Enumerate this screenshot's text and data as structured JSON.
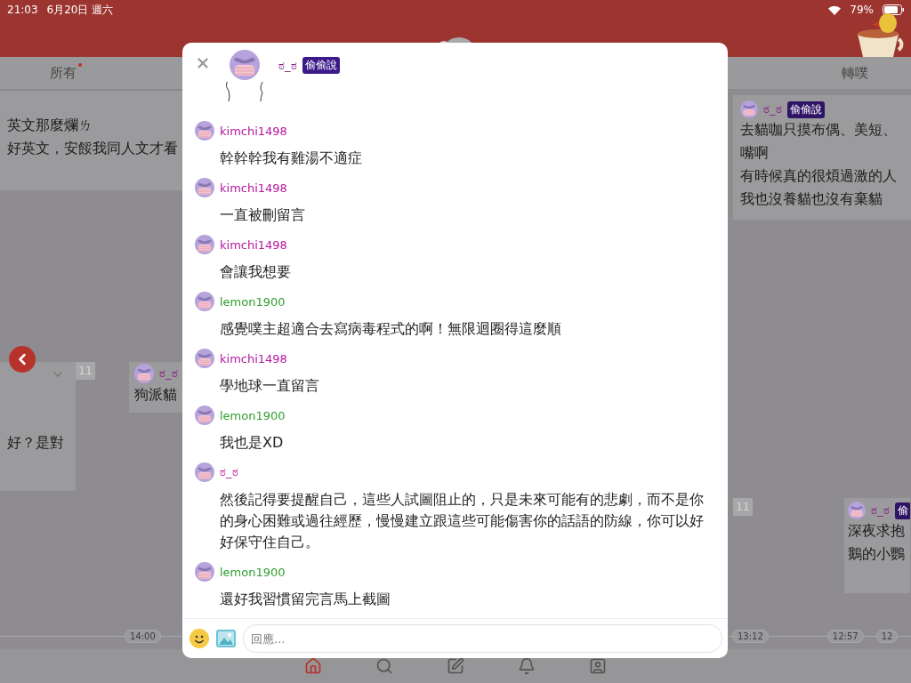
{
  "status_bar": {
    "time": "21:03",
    "date": "6月20日 週六",
    "battery": "79%"
  },
  "tabs": [
    {
      "label": "所有",
      "unread": true
    },
    {
      "label": "轉噗",
      "unread": false
    }
  ],
  "feed_left": {
    "post_1": {
      "lines": [
        "英文那麼爛ㄌ",
        "好英文，安餒我同人文才看"
      ]
    },
    "count": "11",
    "post_2": {
      "lines": [
        "好？是對"
      ]
    },
    "post_3": {
      "author": "ಠ_ಠ",
      "lines": [
        "狗派貓"
      ]
    },
    "time": "14:00"
  },
  "feed_right": {
    "post_1": {
      "author": "ಠ_ಠ",
      "tag": "偷偷說",
      "lines": [
        "去貓咖只摸布偶、美短、",
        "嘴啊",
        "有時候真的很煩過激的人",
        "我也沒養貓也沒有棄貓"
      ]
    },
    "count": "11",
    "post_2": {
      "author": "ಠ_ಠ",
      "tag": "偷",
      "lines": [
        "深夜求抱",
        "鵝的小鸚"
      ]
    },
    "times": [
      "13:12",
      "12:57",
      "12"
    ]
  },
  "dialog": {
    "author": "ಠ_ಠ",
    "tag": "偷偷說",
    "comments": [
      {
        "user": "kimchi1498",
        "color": "#b5179e",
        "text": "幹幹幹我有雞湯不適症"
      },
      {
        "user": "kimchi1498",
        "color": "#b5179e",
        "text": "一直被刪留言"
      },
      {
        "user": "kimchi1498",
        "color": "#b5179e",
        "text": "會讓我想要"
      },
      {
        "user": "lemon1900",
        "color": "#2e9e2e",
        "text": "感覺噗主超適合去寫病毒程式的啊！無限迴圈得這麼順"
      },
      {
        "user": "kimchi1498",
        "color": "#b5179e",
        "text": "學地球一直留言"
      },
      {
        "user": "lemon1900",
        "color": "#2e9e2e",
        "text": "我也是XD"
      },
      {
        "user": "ಠ_ಠ",
        "color": "#b5179e",
        "text": "然後記得要提醒自己，這些人試圖阻止的，只是未來可能有的悲劇，而不是你的身心困難或過往經歷，慢慢建立跟這些可能傷害你的話語的防線，你可以好好保守住自己。"
      },
      {
        "user": "lemon1900",
        "color": "#2e9e2e",
        "text": "還好我習慣留完言馬上截圖"
      }
    ],
    "reply": {
      "placeholder": "回應..."
    }
  }
}
